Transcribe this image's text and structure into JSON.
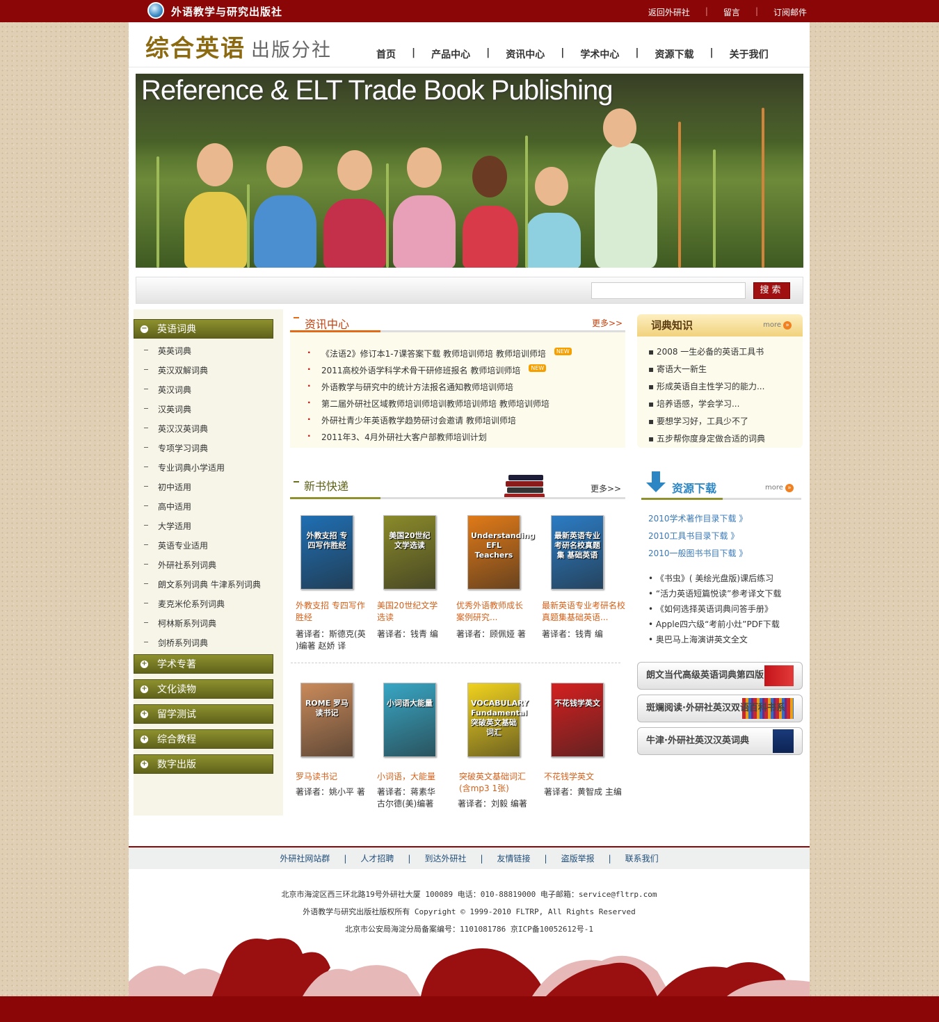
{
  "top": {
    "org_title": "外语教学与研究出版社",
    "links": [
      "返回外研社",
      "留言",
      "订阅邮件"
    ]
  },
  "brand": {
    "main": "综合英语",
    "sub": "出版分社"
  },
  "nav": [
    "首页",
    "产品中心",
    "资讯中心",
    "学术中心",
    "资源下载",
    "关于我们"
  ],
  "banner": {
    "title": "Reference & ELT Trade Book Publishing"
  },
  "search": {
    "value": "",
    "button": "搜索"
  },
  "sidebar": {
    "open_category": "英语词典",
    "sub_items": [
      "英英词典",
      "英汉双解词典",
      "英汉词典",
      "汉英词典",
      "英汉汉英词典",
      "专项学习词典",
      "专业词典小学适用",
      "初中适用",
      "高中适用",
      "大学适用",
      "英语专业适用",
      "外研社系列词典",
      "朗文系列词典 牛津系列词典",
      "麦克米伦系列词典",
      "柯林斯系列词典",
      "剑桥系列词典"
    ],
    "categories": [
      "学术专著",
      "文化读物",
      "留学测试",
      "综合教程",
      "数字出版"
    ]
  },
  "news": {
    "title": "资讯中心",
    "more": "更多>>",
    "items": [
      {
        "text": "《法语2》修订本1-7课答案下载 教师培训师培 教师培训师培",
        "badge": "NEW"
      },
      {
        "text": "2011高校外语学科学术骨干研修班报名 教师培训师培",
        "badge": "NEW"
      },
      {
        "text": "外语教学与研究中的统计方法报名通知教师培训师培",
        "badge": ""
      },
      {
        "text": "第二届外研社区域教师培训师培训教师培训师培 教师培训师培",
        "badge": ""
      },
      {
        "text": "外研社青少年英语教学趋势研讨会邀请 教师培训师培",
        "badge": ""
      },
      {
        "text": "2011年3、4月外研社大客户部教师培训计划",
        "badge": ""
      }
    ]
  },
  "new_books": {
    "title": "新书快递",
    "more": "更多>>",
    "books": [
      {
        "title1": "外教支招 专四写作",
        "title2": "胜经",
        "author1": "著译者：斯德克(英",
        "author2": ")编著 赵娇 译",
        "cover_text": "外教支招 专四写作胜经",
        "cover_color": "#1f6fb3"
      },
      {
        "title1": "美国20世纪文学",
        "title2": "选读",
        "author1": "著译者：钱青 编",
        "author2": "",
        "cover_text": "美国20世纪文学选读",
        "cover_color": "#8a8a2a"
      },
      {
        "title1": "优秀外语教师成长",
        "title2": "案例研究...",
        "author1": "著译者：顾佩娅 著",
        "author2": "",
        "cover_text": "Understanding EFL Teachers",
        "cover_color": "#e07a18"
      },
      {
        "title1": "最新英语专业考研名校",
        "title2": "真题集基础英语...",
        "author1": "著译者：钱青 编",
        "author2": "",
        "cover_text": "最新英语专业考研名校真题集 基础英语",
        "cover_color": "#2b7cc4"
      },
      {
        "title1": "罗马读书记",
        "title2": "",
        "author1": "著译者：姚小平 著",
        "author2": "",
        "cover_text": "ROME 罗马读书记",
        "cover_color": "#c98a5a"
      },
      {
        "title1": "小词语，大能量",
        "title2": "",
        "author1": "著译者：蒋素华",
        "author2": "古尔德(美)编著",
        "cover_text": "小词语大能量",
        "cover_color": "#38a6c4"
      },
      {
        "title1": "突破英文基础词汇",
        "title2": "(含mp3 1张)",
        "author1": "著译者：刘毅 编著",
        "author2": "",
        "cover_text": "VOCABULARY Fundamental 突破英文基础词汇",
        "cover_color": "#f0d21e"
      },
      {
        "title1": "不花钱学英文",
        "title2": "",
        "author1": "著译者：黄智成 主编",
        "author2": "",
        "cover_text": "不花钱学英文",
        "cover_color": "#d42020"
      }
    ]
  },
  "dict_knowledge": {
    "title": "词典知识",
    "more": "more",
    "items": [
      "2008 一生必备的英语工具书",
      "寄语大一新生",
      "形成英语自主性学习的能力...",
      "培养语感，学会学习...",
      "要想学习好，工具少不了",
      "五步帮你度身定做合适的词典"
    ]
  },
  "downloads": {
    "title": "资源下载",
    "more": "more",
    "links": [
      "2010学术著作目录下载",
      "2010工具书目录下载",
      "2010一般图书书目下载"
    ],
    "items": [
      "《书虫》( 美绘光盘版)课后练习",
      "“活力英语短篇悦读”参考译文下载",
      "《如何选择英语词典问答手册》",
      "Apple四六级“考前小灶”PDF下载",
      "奥巴马上海演讲英文全文"
    ]
  },
  "promos": [
    "朗文当代高级英语词典第四版",
    "斑斓阅读·外研社英汉双语百科书系",
    "牛津·外研社英汉汉英词典"
  ],
  "footer": {
    "links": [
      "外研社网站群",
      "人才招聘",
      "到达外研社",
      "友情链接",
      "盗版举报",
      "联系我们"
    ],
    "line1": "北京市海淀区西三环北路19号外研社大厦 100089    电话：010-88819000    电子邮箱：service@fltrp.com",
    "line2": "外语教学与研究出版社版权所有 Copyright © 1999-2010 FLTRP, All Rights Reserved",
    "line3": "北京市公安局海淀分局备案编号：1101081786    京ICP备10052612号-1"
  },
  "colors": {
    "brand_red": "#8b0606",
    "accent_orange": "#e26b18",
    "olive": "#6b6e20"
  }
}
